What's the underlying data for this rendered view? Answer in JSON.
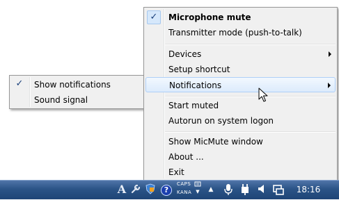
{
  "main_menu": {
    "microphone_mute": "Microphone mute",
    "transmitter_mode": "Transmitter mode (push-to-talk)",
    "devices": "Devices",
    "setup_shortcut": "Setup shortcut",
    "notifications": "Notifications",
    "start_muted": "Start muted",
    "autorun": "Autorun on system logon",
    "show_window": "Show MicMute window",
    "about": "About ...",
    "exit": "Exit",
    "microphone_mute_checked": true
  },
  "submenu": {
    "show_notifications": "Show notifications",
    "sound_signal": "Sound signal",
    "show_notifications_checked": true
  },
  "taskbar": {
    "ime_label": "A",
    "caps_label": "CAPS",
    "kana_label": "KANA",
    "clock": "18:16",
    "icons": [
      "ime-a-icon",
      "tools-icon",
      "shield-icon",
      "help-icon",
      "ime-mode-icon",
      "show-hidden-icons-arrow",
      "microphone-icon",
      "power-plug-icon",
      "volume-icon",
      "network-icon"
    ]
  },
  "colors": {
    "menu_background": "#f0f0f0",
    "highlight": "#dcebfc",
    "taskbar": "#2b5487"
  }
}
